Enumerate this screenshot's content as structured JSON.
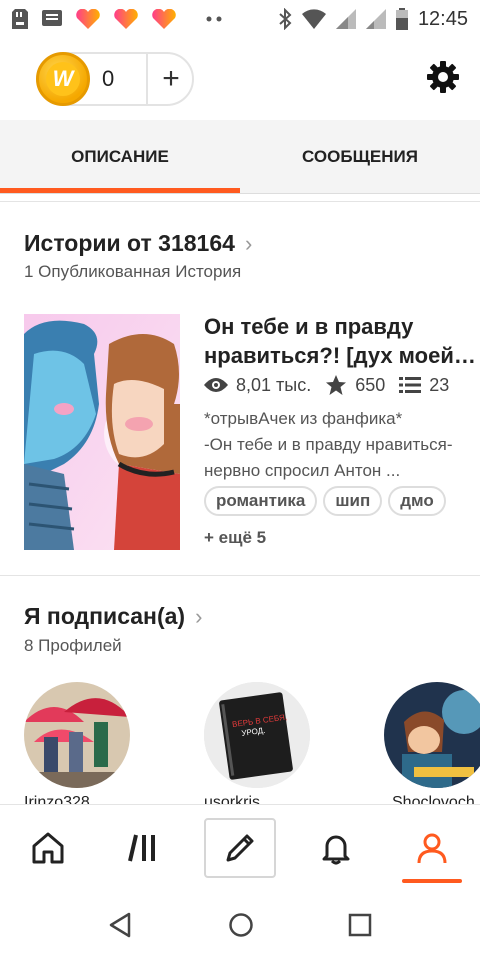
{
  "status_bar": {
    "time": "12:45"
  },
  "wallet": {
    "coin_letter": "W",
    "coin_count": "0",
    "add_label": "+"
  },
  "tabs": [
    {
      "label": "ОПИСАНИЕ",
      "active": true
    },
    {
      "label": "СООБЩЕНИЯ",
      "active": false
    }
  ],
  "stories": {
    "title": "Истории от 318164",
    "subtitle": "1 Опубликованная История",
    "item": {
      "title_line1": "Он тебе и в правду",
      "title_line2": "нравиться?! [дух моей…",
      "views": "8,01 тыс.",
      "votes": "650",
      "parts": "23",
      "desc_line1": "*отрывАчек из фанфика*",
      "desc_line2": "-Он тебе и в правду нравиться-",
      "desc_line3": "нервно спросил Антон ...",
      "tags": [
        "романтика",
        "шип",
        "дмо"
      ],
      "more": "+ ещё 5"
    }
  },
  "following": {
    "title": "Я подписан(а)",
    "subtitle": "8 Профилей",
    "profiles": [
      {
        "name": "Irinzo328",
        "avatar_icon": "umbrellas-photo"
      },
      {
        "name": "usorkris",
        "avatar_icon": "notebook-photo",
        "avatar_text1": "ВЕРЬ В СЕБЯ,",
        "avatar_text2": "УРОД."
      },
      {
        "name": "Shoclovoch",
        "avatar_icon": "cartoon-boy-photo"
      }
    ]
  },
  "colors": {
    "accent": "#ff5a1f",
    "coin": "#f5a800"
  }
}
